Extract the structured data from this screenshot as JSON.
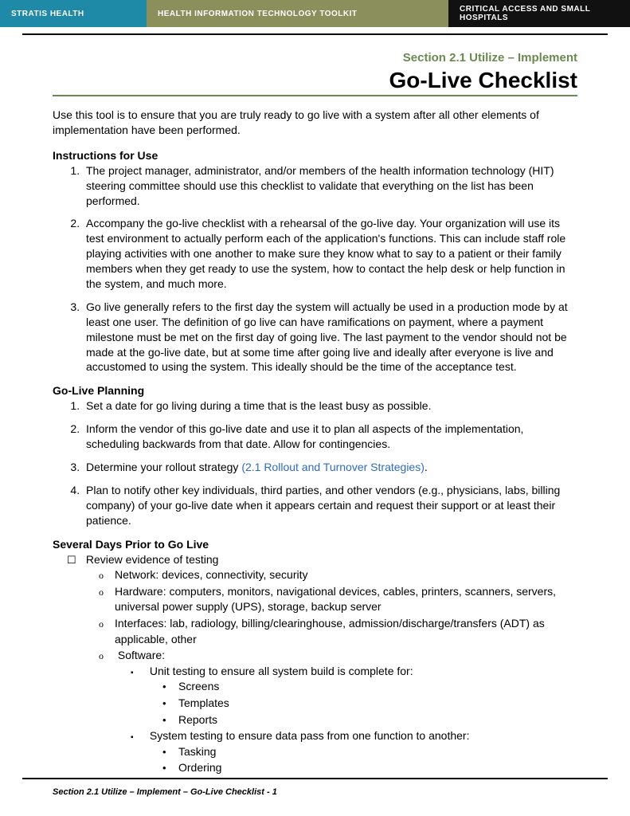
{
  "header": {
    "left": "STRATIS HEALTH",
    "center": "HEALTH INFORMATION TECHNOLOGY TOOLKIT",
    "right": "CRITICAL ACCESS AND SMALL HOSPITALS"
  },
  "section_label": "Section 2.1 Utilize – Implement",
  "title": "Go-Live Checklist",
  "intro": "Use this tool is to ensure that you are truly ready to go live with a system after all other elements of implementation have been performed.",
  "instructions": {
    "heading": "Instructions for Use",
    "items": [
      "The project manager, administrator, and/or members of the health information technology (HIT) steering committee should use this checklist to validate that everything on the list has been performed.",
      "Accompany the go-live checklist with a rehearsal of the go-live day. Your organization will use its test environment to actually perform each of the application's functions. This can include staff role playing activities with one another to make sure they know what to say to a patient or their family members when they get ready to use the system, how to contact the help desk or help function in the system, and much more.",
      "Go live generally refers to the first day the system will actually be used in a production mode by at least one user. The definition of go live can have ramifications on payment, where a payment milestone must be met on the first day of going live. The last payment to the vendor should not be made at the go-live date, but at some time after going live and ideally after everyone is live and accustomed to using the system. This ideally should be the time of the acceptance test."
    ]
  },
  "planning": {
    "heading": "Go-Live Planning",
    "items": [
      "Set a date for go living during a time that is the least busy as possible.",
      "Inform the vendor of this go-live date and use it to plan all aspects of the implementation, scheduling backwards from that date. Allow for contingencies.",
      {
        "pre": "Determine your rollout strategy ",
        "link": "(2.1 Rollout and Turnover Strategies)",
        "post": "."
      },
      "Plan to notify other key individuals, third parties, and other vendors (e.g., physicians, labs, billing company) of your go-live date when it appears certain and request their support or at least their patience."
    ]
  },
  "days_prior": {
    "heading": "Several Days Prior to Go Live",
    "check": "Review evidence of testing",
    "circle": [
      "Network: devices, connectivity, security",
      "Hardware: computers, monitors, navigational devices, cables, printers, scanners, servers, universal power supply (UPS), storage, backup server",
      "Interfaces: lab, radiology, billing/clearinghouse, admission/discharge/transfers (ADT) as applicable, other",
      "Software:"
    ],
    "square": [
      {
        "label": "Unit testing to ensure all system build is complete for:",
        "bullets": [
          "Screens",
          "Templates",
          "Reports"
        ]
      },
      {
        "label": "System testing to ensure data pass from one function to another:",
        "bullets": [
          "Tasking",
          "Ordering"
        ]
      }
    ]
  },
  "footer": "Section 2.1 Utilize – Implement – Go-Live Checklist - 1"
}
